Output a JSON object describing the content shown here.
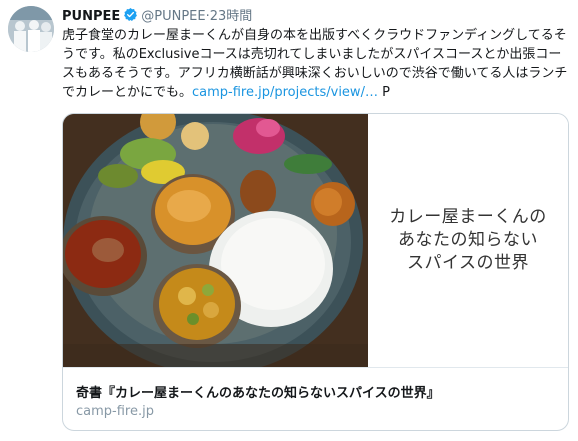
{
  "tweet": {
    "display_name": "PUNPEE",
    "handle": "@PUNPEE",
    "separator": "·",
    "timestamp": "23時間",
    "text_lines": [
      "虎子食堂のカレー屋まーくんが自身の本を出版すべくクラウドファンディングし",
      "てるそうです。私のExclusiveコースは売切れてしまいましたがスパイスコースと",
      "か出張コースもあるそうです。アフリカ横断話が興味深くおいしいので渋谷で働",
      "いてる人はランチでカレーとかにでも。"
    ],
    "link_text": "camp-fire.jp/projects/view/…",
    "trailing_text": " P"
  },
  "card": {
    "cover_lines": [
      "カレー屋まーくんの",
      "あなたの知らない",
      "スパイスの世界"
    ],
    "title": "奇書『カレー屋まーくんのあなたの知らないスパイスの世界』",
    "domain": "camp-fire.jp"
  },
  "colors": {
    "link": "#1b95e0",
    "verified": "#1da1f2",
    "muted": "#657786",
    "border": "#ccd6dd"
  },
  "icons": {
    "verified": "verified-badge-icon",
    "avatar": "avatar"
  }
}
